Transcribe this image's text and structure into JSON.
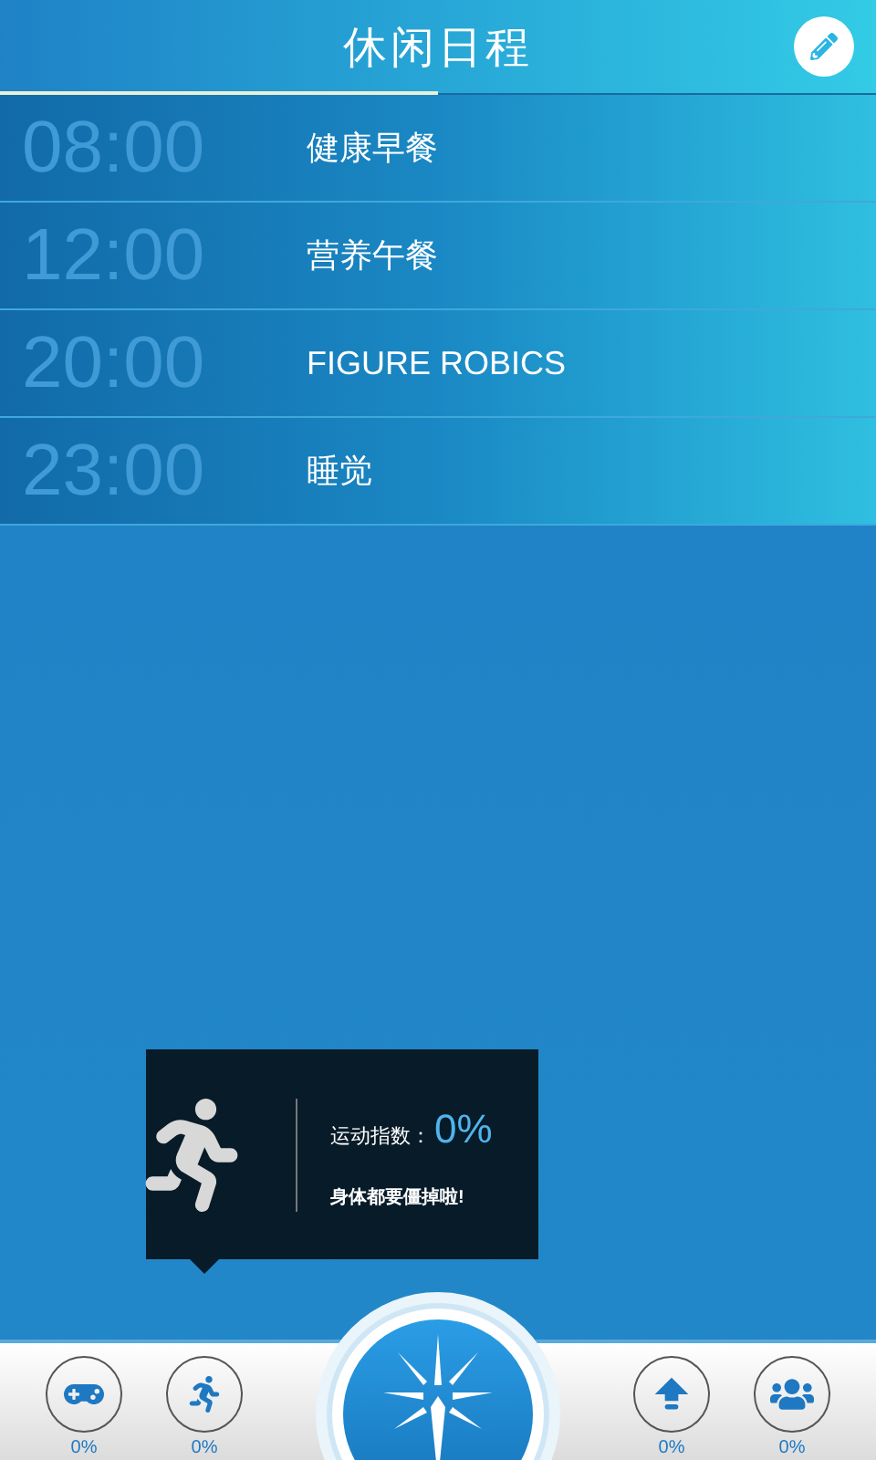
{
  "header": {
    "title": "休闲日程"
  },
  "schedule": [
    {
      "time": "08:00",
      "event": "健康早餐"
    },
    {
      "time": "12:00",
      "event": "营养午餐"
    },
    {
      "time": "20:00",
      "event": "FIGURE ROBICS"
    },
    {
      "time": "23:00",
      "event": "睡觉"
    }
  ],
  "tooltip": {
    "label": "运动指数：",
    "value": "0%",
    "message": "身体都要僵掉啦!"
  },
  "bottom_bar": [
    {
      "kind": "game",
      "reading": "0%"
    },
    {
      "kind": "run",
      "reading": "0%"
    },
    {
      "kind": "upload",
      "reading": "0%"
    },
    {
      "kind": "group",
      "reading": "0%"
    }
  ]
}
